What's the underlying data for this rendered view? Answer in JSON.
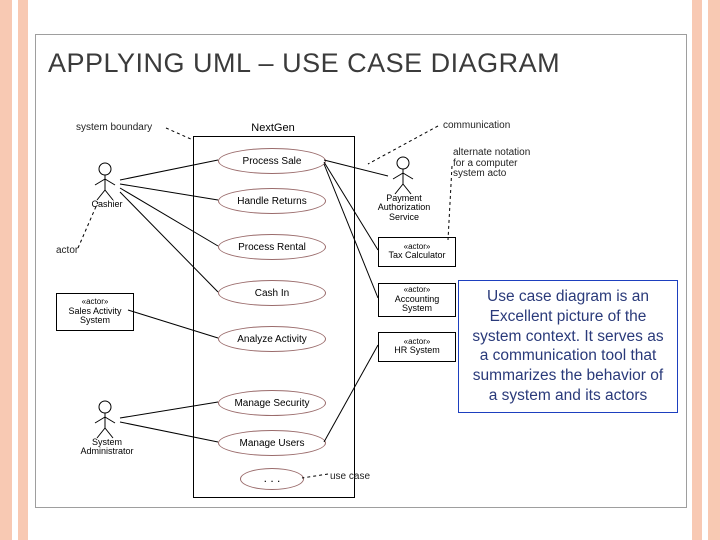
{
  "title": "APPLYING UML – USE CASE DIAGRAM",
  "system_name": "NextGen",
  "annotations": {
    "system_boundary": "system boundary",
    "communication": "communication",
    "actor": "actor",
    "use_case": "use case",
    "alternate": "alternate notation for a computer system acto"
  },
  "actors": {
    "cashier": "Cashier",
    "sys_admin": "System Administrator",
    "payment": "Payment Authorization Service",
    "sales_activity": {
      "stereo": "«actor»",
      "name": "Sales Activity System"
    },
    "tax_calc": {
      "stereo": "«actor»",
      "name": "Tax Calculator"
    },
    "accounting": {
      "stereo": "«actor»",
      "name": "Accounting System"
    },
    "hr": {
      "stereo": "«actor»",
      "name": "HR System"
    }
  },
  "use_cases": {
    "process_sale": "Process Sale",
    "handle_returns": "Handle Returns",
    "process_rental": "Process Rental",
    "cash_in": "Cash In",
    "analyze_activity": "Analyze Activity",
    "manage_security": "Manage Security",
    "manage_users": "Manage Users",
    "ellipsis": ". . ."
  },
  "note_text": "Use case diagram is an Excellent picture of the system context. It serves as a communication tool that summarizes the behavior of a system and its actors"
}
